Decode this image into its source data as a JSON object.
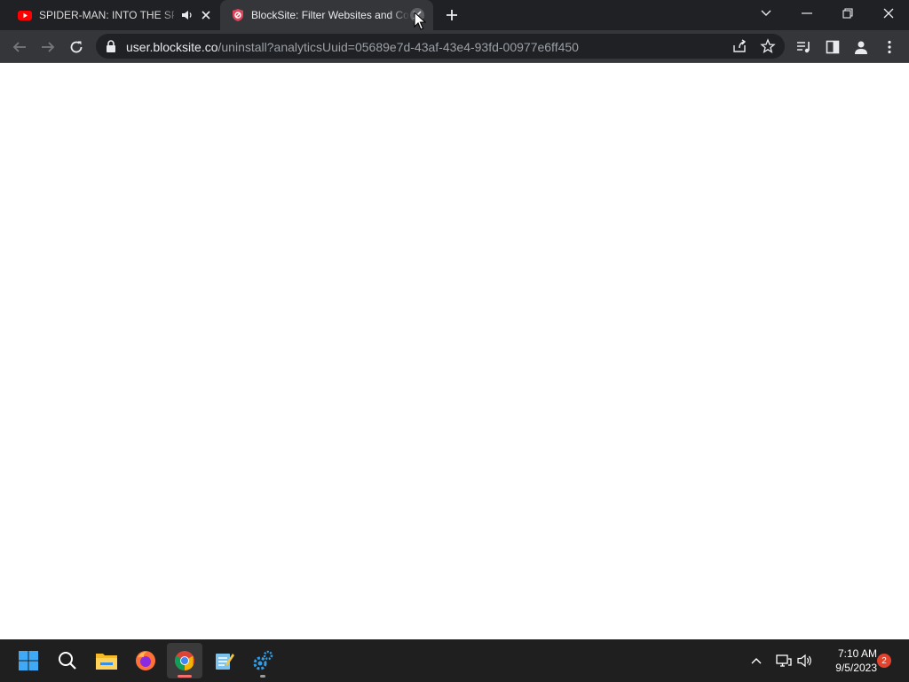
{
  "browser": {
    "tabs": [
      {
        "title": "SPIDER-MAN: INTO THE SPIDER-VERSE",
        "favicon": "youtube-icon",
        "audio": true,
        "active": false
      },
      {
        "title": "BlockSite: Filter Websites and Control",
        "favicon": "blocksite-shield-icon",
        "active": true
      }
    ],
    "address": {
      "host": "user.blocksite.co",
      "path": "/uninstall?analyticsUuid=05689e7d-43af-43e4-93fd-00977e6ff450"
    }
  },
  "taskbar": {
    "apps": [
      "windows-start-icon",
      "search-icon",
      "file-explorer-icon",
      "firefox-icon",
      "chrome-icon",
      "notepad-icon",
      "settings-gear-icon"
    ],
    "clock": {
      "time": "7:10 AM",
      "date": "9/5/2023"
    },
    "notification_count": "2"
  },
  "colors": {
    "tabstrip": "#202124",
    "toolbar": "#35363a",
    "page": "#ffffff",
    "taskbar": "#1f1f1f",
    "youtube_red": "#ff0000",
    "blocksite_red": "#e0445a",
    "notification_badge": "#e3432d"
  }
}
